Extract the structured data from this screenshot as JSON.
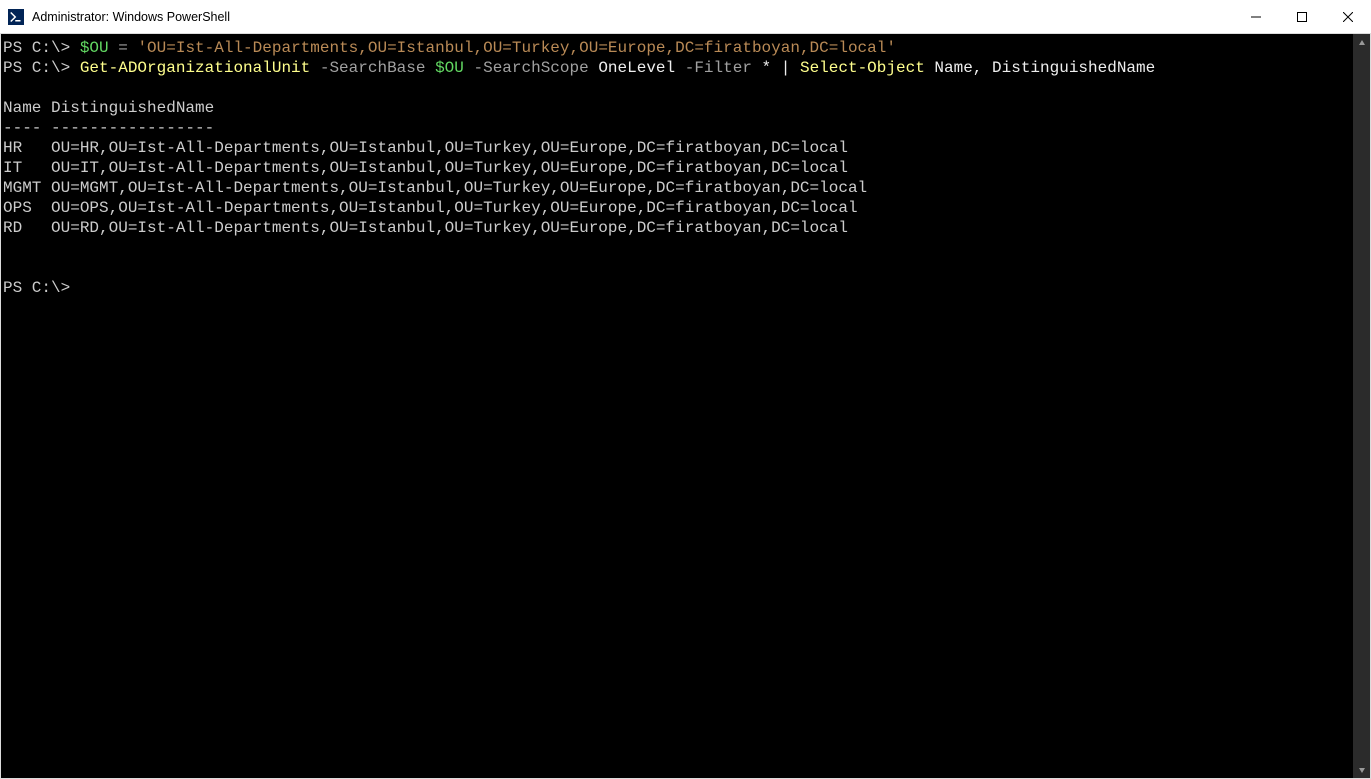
{
  "window": {
    "title": "Administrator: Windows PowerShell"
  },
  "terminal": {
    "line1": {
      "prompt": "PS C:\\> ",
      "var": "$OU",
      "eq": " = ",
      "str": "'OU=Ist-All-Departments,OU=Istanbul,OU=Turkey,OU=Europe,DC=firatboyan,DC=local'"
    },
    "line2": {
      "prompt": "PS C:\\> ",
      "cmd": "Get-ADOrganizationalUnit",
      "param1": " -SearchBase ",
      "var": "$OU",
      "param2": " -SearchScope ",
      "val2": "OneLevel",
      "param3": " -Filter ",
      "val3": "*",
      "pipe": " | ",
      "cmd2": "Select-Object",
      "val4": " Name, DistinguishedName"
    },
    "header": "Name DistinguishedName",
    "ruler": "---- -----------------",
    "rows": [
      {
        "name": "HR  ",
        "dn": " OU=HR,OU=Ist-All-Departments,OU=Istanbul,OU=Turkey,OU=Europe,DC=firatboyan,DC=local"
      },
      {
        "name": "IT  ",
        "dn": " OU=IT,OU=Ist-All-Departments,OU=Istanbul,OU=Turkey,OU=Europe,DC=firatboyan,DC=local"
      },
      {
        "name": "MGMT",
        "dn": " OU=MGMT,OU=Ist-All-Departments,OU=Istanbul,OU=Turkey,OU=Europe,DC=firatboyan,DC=local"
      },
      {
        "name": "OPS ",
        "dn": " OU=OPS,OU=Ist-All-Departments,OU=Istanbul,OU=Turkey,OU=Europe,DC=firatboyan,DC=local"
      },
      {
        "name": "RD  ",
        "dn": " OU=RD,OU=Ist-All-Departments,OU=Istanbul,OU=Turkey,OU=Europe,DC=firatboyan,DC=local"
      }
    ],
    "final_prompt": "PS C:\\>"
  }
}
